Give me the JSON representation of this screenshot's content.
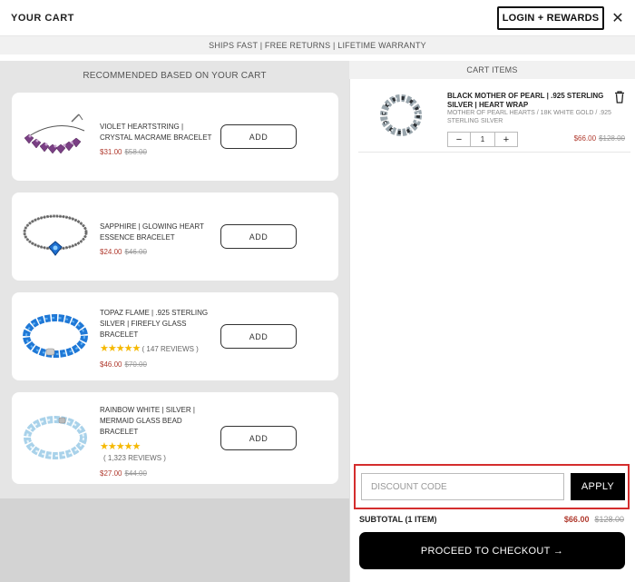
{
  "header": {
    "title": "YOUR CART",
    "login_label": "LOGIN + REWARDS",
    "close_label": "✕"
  },
  "banner": {
    "text": "SHIPS FAST | FREE RETURNS | LIFETIME WARRANTY"
  },
  "recommended": {
    "title": "RECOMMENDED BASED ON YOUR CART",
    "add_label": "ADD",
    "items": [
      {
        "name": "VIOLET HEARTSTRING | CRYSTAL MACRAME BRACELET",
        "price": "$31.00",
        "original_price": "$58.00"
      },
      {
        "name": "SAPPHIRE | GLOWING HEART ESSENCE BRACELET",
        "price": "$24.00",
        "original_price": "$46.00"
      },
      {
        "name": "TOPAZ FLAME | .925 STERLING SILVER | FIREFLY GLASS BRACELET",
        "stars": "★★★★★",
        "reviews": "( 147 REVIEWS )",
        "price": "$46.00",
        "original_price": "$70.00"
      },
      {
        "name": "RAINBOW WHITE | SILVER | MERMAID GLASS BEAD BRACELET",
        "stars": "★★★★★",
        "reviews": "( 1,323 REVIEWS )",
        "price": "$27.00",
        "original_price": "$44.00"
      }
    ]
  },
  "cart": {
    "header": "CART ITEMS",
    "items": [
      {
        "name": "BLACK MOTHER OF PEARL | .925 STERLING SILVER | HEART WRAP",
        "variant": "MOTHER OF PEARL HEARTS / 18K WHITE GOLD / .925 STERLING SILVER",
        "quantity": "1",
        "price": "$66.00",
        "original_price": "$128.00"
      }
    ],
    "qty_minus": "−",
    "qty_plus": "+"
  },
  "discount": {
    "placeholder": "DISCOUNT CODE",
    "apply_label": "APPLY"
  },
  "summary": {
    "subtotal_label": "SUBTOTAL (1 ITEM)",
    "subtotal": "$66.00",
    "subtotal_original": "$128.00"
  },
  "checkout": {
    "label": "PROCEED TO CHECKOUT →"
  },
  "colors": {
    "sale_price": "#b03a2e",
    "star": "#f5b800",
    "highlight_border": "#d42d2d"
  }
}
